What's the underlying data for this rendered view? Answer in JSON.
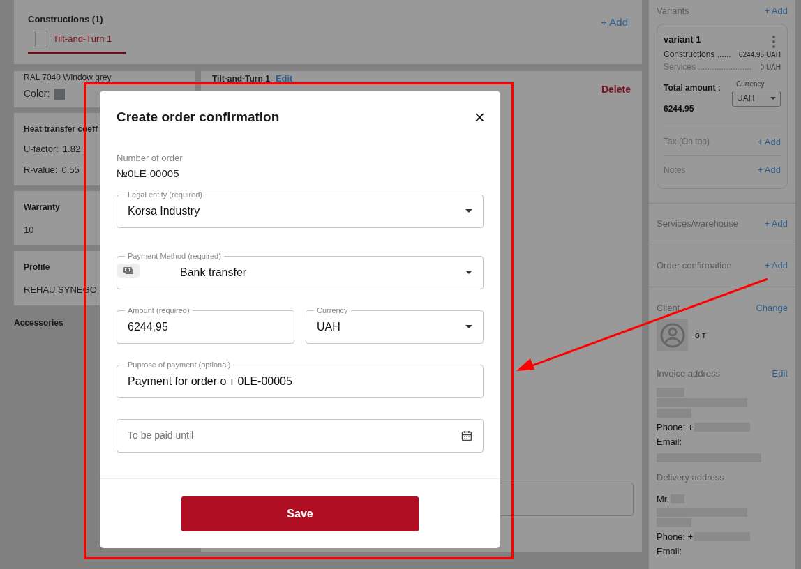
{
  "constructions": {
    "title": "Constructions (1)",
    "add": "+ Add",
    "tabs": [
      {
        "label": "Tilt-and-Turn 1",
        "selected": true
      }
    ]
  },
  "left_cards": [
    {
      "kind": "color",
      "top_text": "RAL 7040 Window grey",
      "label": "Color:"
    },
    {
      "kind": "values",
      "title": "Heat transfer coeff",
      "rows": [
        {
          "label": "U-factor:",
          "value": "1.82"
        },
        {
          "label": "R-value:",
          "value": "0.55"
        }
      ]
    },
    {
      "kind": "plain",
      "title": "Warranty",
      "value": "10"
    },
    {
      "kind": "plain",
      "title": "Profile",
      "value": "REHAU SYNEGO"
    }
  ],
  "accessories": "Accessories",
  "construction_panel": {
    "title": "Tilt-and-Turn 1",
    "edit": "Edit",
    "delete": "Delete"
  },
  "sidebar": {
    "variants": {
      "title": "Variants",
      "add": "+ Add",
      "card": {
        "name": "variant 1",
        "lines": [
          {
            "label": "Constructions ......",
            "value": "6244.95 UAH",
            "muted": false
          },
          {
            "label": "Services .......................",
            "value": "0 UAH",
            "muted": true
          }
        ],
        "total_label": "Total amount :",
        "total": "6244.95",
        "currency_label": "Currency",
        "currency": "UAH",
        "extras": [
          {
            "label": "Tax (On top)",
            "add": "+ Add"
          },
          {
            "label": "Notes",
            "add": "+ Add"
          }
        ]
      }
    },
    "sections": [
      {
        "label": "Services/warehouse",
        "add": "+ Add"
      },
      {
        "label": "Order confirmation",
        "add": "+ Add"
      }
    ],
    "client": {
      "title": "Client",
      "change": "Change",
      "name": "o т"
    },
    "invoice": {
      "title": "Invoice address",
      "edit": "Edit",
      "phone": "Phone: +",
      "email": "Email:"
    },
    "delivery": {
      "title": "Delivery address",
      "name": "Mr,",
      "phone": "Phone: +",
      "email": "Email:"
    }
  },
  "dialog": {
    "title": "Create order confirmation",
    "close": "×",
    "order_label": "Number of order",
    "order_number": "№0LE-00005",
    "fields": [
      {
        "kind": "select",
        "label": "Legal entity (required)",
        "value": "Korsa Industry"
      },
      {
        "kind": "payment",
        "label": "Payment Method (required)",
        "value": "Bank transfer"
      },
      {
        "kind": "pair",
        "items": [
          {
            "kind": "text",
            "label": "Amount (required)",
            "value": "6244,95"
          },
          {
            "kind": "select",
            "label": "Currency",
            "value": "UAH"
          }
        ]
      },
      {
        "kind": "text",
        "label": "Puprose of payment (optional)",
        "value": "Payment for order o т 0LE-00005"
      },
      {
        "kind": "date",
        "placeholder": "To be paid until"
      }
    ],
    "save": "Save"
  }
}
